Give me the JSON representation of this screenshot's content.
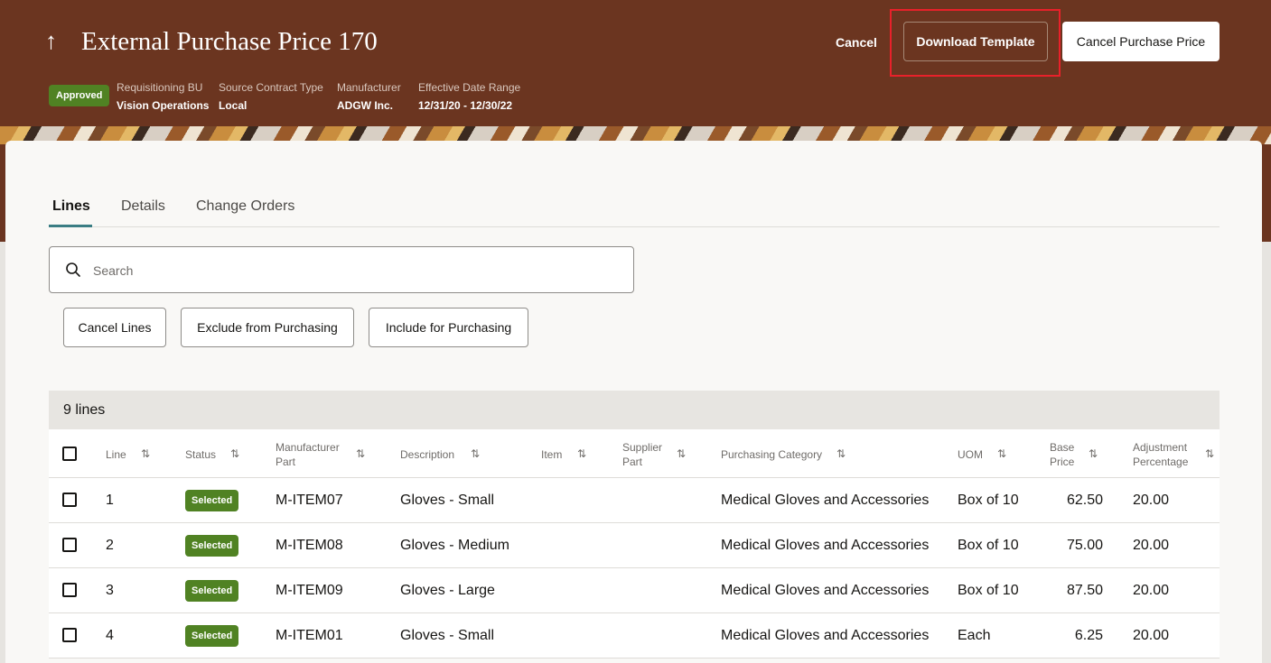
{
  "header": {
    "title": "External Purchase Price 170",
    "cancel_label": "Cancel",
    "download_template_label": "Download Template",
    "cancel_purchase_price_label": "Cancel Purchase Price",
    "status_badge": "Approved",
    "meta": [
      {
        "label": "Requisitioning BU",
        "value": "Vision Operations"
      },
      {
        "label": "Source Contract Type",
        "value": "Local"
      },
      {
        "label": "Manufacturer",
        "value": "ADGW Inc."
      },
      {
        "label": "Effective Date Range",
        "value": "12/31/20 - 12/30/22"
      }
    ]
  },
  "tabs": [
    {
      "label": "Lines",
      "active": true
    },
    {
      "label": "Details",
      "active": false
    },
    {
      "label": "Change Orders",
      "active": false
    }
  ],
  "search": {
    "placeholder": "Search",
    "value": ""
  },
  "actions": {
    "cancel_lines": "Cancel Lines",
    "exclude": "Exclude from Purchasing",
    "include": "Include for Purchasing"
  },
  "table": {
    "count_label": "9 lines",
    "columns": {
      "line": "Line",
      "status": "Status",
      "manufacturer_part_1": "Manufacturer",
      "manufacturer_part_2": "Part",
      "description": "Description",
      "item": "Item",
      "supplier_part_1": "Supplier",
      "supplier_part_2": "Part",
      "category": "Purchasing Category",
      "uom": "UOM",
      "base_price_1": "Base",
      "base_price_2": "Price",
      "adjustment_1": "Adjustment",
      "adjustment_2": "Percentage"
    },
    "rows": [
      {
        "line": "1",
        "status": "Selected",
        "mpart": "M-ITEM07",
        "description": "Gloves - Small",
        "item": "",
        "spart": "",
        "category": "Medical Gloves and Accessories",
        "uom": "Box of 10",
        "base_price": "62.50",
        "adjustment": "20.00"
      },
      {
        "line": "2",
        "status": "Selected",
        "mpart": "M-ITEM08",
        "description": "Gloves - Medium",
        "item": "",
        "spart": "",
        "category": "Medical Gloves and Accessories",
        "uom": "Box of 10",
        "base_price": "75.00",
        "adjustment": "20.00"
      },
      {
        "line": "3",
        "status": "Selected",
        "mpart": "M-ITEM09",
        "description": "Gloves - Large",
        "item": "",
        "spart": "",
        "category": "Medical Gloves and Accessories",
        "uom": "Box of 10",
        "base_price": "87.50",
        "adjustment": "20.00"
      },
      {
        "line": "4",
        "status": "Selected",
        "mpart": "M-ITEM01",
        "description": "Gloves - Small",
        "item": "",
        "spart": "",
        "category": "Medical Gloves and Accessories",
        "uom": "Each",
        "base_price": "6.25",
        "adjustment": "20.00"
      }
    ]
  },
  "colors": {
    "header_bg": "#6b3520",
    "status_green": "#508223",
    "focus_outline": "#e8212a",
    "tab_accent": "#3a7d84"
  }
}
